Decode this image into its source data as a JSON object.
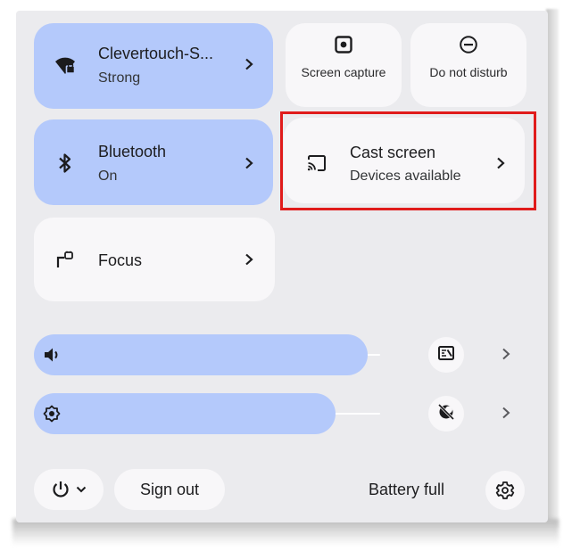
{
  "network": {
    "title": "Clevertouch-S...",
    "subtitle": "Strong",
    "icon": "wifi-locked-icon"
  },
  "screen_capture": {
    "label": "Screen capture",
    "icon": "screen-capture-icon"
  },
  "do_not_disturb": {
    "label": "Do not disturb",
    "icon": "do-not-disturb-icon"
  },
  "bluetooth": {
    "title": "Bluetooth",
    "subtitle": "On",
    "icon": "bluetooth-icon"
  },
  "cast": {
    "title": "Cast screen",
    "subtitle": "Devices available",
    "icon": "cast-icon"
  },
  "focus": {
    "title": "Focus",
    "icon": "focus-icon"
  },
  "volume": {
    "icon": "speaker-icon",
    "level": 0.83,
    "side_icon": "audio-settings-icon"
  },
  "brightness": {
    "icon": "brightness-icon",
    "level": 0.75,
    "side_icon": "night-light-off-icon"
  },
  "footer": {
    "power_icon": "power-icon",
    "sign_out_label": "Sign out",
    "battery_label": "Battery full",
    "settings_icon": "gear-icon"
  },
  "colors": {
    "panel": "#ebebee",
    "tile_on": "#b4c9fb",
    "tile_off": "#f8f7f9",
    "highlight": "#e01b1b"
  }
}
